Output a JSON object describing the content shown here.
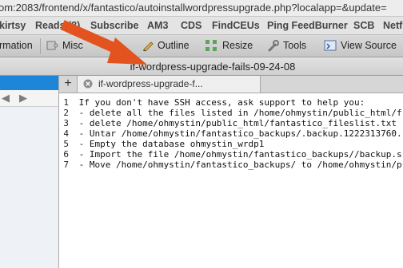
{
  "browser": {
    "url": "om:2083/frontend/x/fantastico/autoinstallwordpressupgrade.php?localapp=&update="
  },
  "bookmarks": [
    "kirtsy",
    "Reads (8)",
    "Subscribe",
    "AM3",
    "CDS",
    "FindCEUs",
    "Ping FeedBurner",
    "SCB",
    "Netf"
  ],
  "toolbar": {
    "items": [
      "rmation",
      "Misc",
      "us",
      "Outline",
      "Resize",
      "Tools",
      "View Source"
    ],
    "icons": [
      "puzzle-icon",
      "pencil-icon",
      "resize-icon",
      "wrench-icon",
      "view-source-icon"
    ]
  },
  "window": {
    "title": "if-wordpress-upgrade-fails-09-24-08"
  },
  "tabs": {
    "new_tab": "+",
    "active_label": "if-wordpress-upgrade-f..."
  },
  "editor": {
    "lines": [
      {
        "num": "1",
        "text": "If you don't have SSH access, ask support to help you:"
      },
      {
        "num": "2",
        "text": "- delete all the files listed in /home/ohmystin/public_html/f"
      },
      {
        "num": "3",
        "text": "- delete /home/ohmystin/public_html/fantastico_fileslist.txt"
      },
      {
        "num": "4",
        "text": "- Untar /home/ohmystin/fantastico_backups/.backup.1222313760."
      },
      {
        "num": "5",
        "text": "- Empty the database ohmystin_wrdp1"
      },
      {
        "num": "6",
        "text": "- Import the file /home/ohmystin/fantastico_backups//backup.s"
      },
      {
        "num": "7",
        "text": "- Move /home/ohmystin/fantastico_backups/ to /home/ohmystin/p"
      }
    ]
  },
  "colors": {
    "arrow": "#e2531f",
    "sidebar_selection": "#1d86d8"
  }
}
